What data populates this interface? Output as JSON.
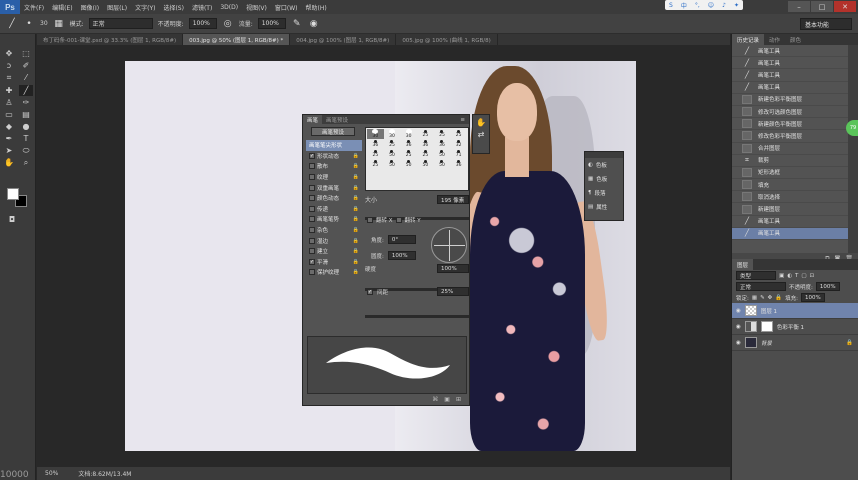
{
  "app": {
    "logo": "Ps"
  },
  "menu": [
    "文件(F)",
    "编辑(E)",
    "图像(I)",
    "图层(L)",
    "文字(Y)",
    "选择(S)",
    "滤镜(T)",
    "3D(D)",
    "视图(V)",
    "窗口(W)",
    "帮助(H)"
  ],
  "options": {
    "size": "30",
    "mode_label": "模式:",
    "mode_value": "正常",
    "opacity_label": "不透明度:",
    "opacity_value": "100%",
    "flow_label": "流量:",
    "flow_value": "100%",
    "workspace": "基本功能"
  },
  "doc_tabs": [
    {
      "label": "布丁码条-001-课堂.psd @ 33.3% (图层 1, RGB/8#)",
      "active": false
    },
    {
      "label": "003.jpg @ 50% (图层 1, RGB/8#) *",
      "active": true
    },
    {
      "label": "004.jpg @ 100% (图层 1, RGB/8#)",
      "active": false
    },
    {
      "label": "005.jpg @ 100% (曲线 1, RGB/8)",
      "active": false
    }
  ],
  "status": {
    "zoom": "50%",
    "doc_info": "文档:8.62M/13.4M"
  },
  "corner_text": "10000",
  "brush_panel": {
    "tabs": [
      "画笔",
      "画笔预设"
    ],
    "preset_button": "画笔预设",
    "options": [
      {
        "label": "画笔笔尖形状",
        "checked": null,
        "selected": true
      },
      {
        "label": "形状动态",
        "checked": true
      },
      {
        "label": "散布",
        "checked": false
      },
      {
        "label": "纹理",
        "checked": false
      },
      {
        "label": "双重画笔",
        "checked": false
      },
      {
        "label": "颜色动态",
        "checked": false
      },
      {
        "label": "传递",
        "checked": false
      },
      {
        "label": "画笔笔势",
        "checked": false
      },
      {
        "label": "杂色",
        "checked": false
      },
      {
        "label": "湿边",
        "checked": false
      },
      {
        "label": "建立",
        "checked": false
      },
      {
        "label": "平滑",
        "checked": true
      },
      {
        "label": "保护纹理",
        "checked": false
      }
    ],
    "tips": [
      {
        "size": "30"
      },
      {
        "size": "30"
      },
      {
        "size": "30"
      },
      {
        "size": "25"
      },
      {
        "size": "25"
      },
      {
        "size": "25"
      },
      {
        "size": "36"
      },
      {
        "size": "25"
      },
      {
        "size": "36"
      },
      {
        "size": "36"
      },
      {
        "size": "36"
      },
      {
        "size": "32"
      },
      {
        "size": "25"
      },
      {
        "size": "50"
      },
      {
        "size": "25"
      },
      {
        "size": "25"
      },
      {
        "size": "50"
      },
      {
        "size": "71"
      },
      {
        "size": "25"
      },
      {
        "size": "50"
      },
      {
        "size": "50"
      },
      {
        "size": "50"
      },
      {
        "size": "50"
      },
      {
        "size": "36"
      }
    ],
    "size_label": "大小",
    "size_value": "195 像素",
    "flip_x": "翻转 X",
    "flip_y": "翻转 Y",
    "angle_label": "角度:",
    "angle_value": "0°",
    "round_label": "圆度:",
    "round_value": "100%",
    "hardness_label": "硬度",
    "hardness_value": "100%",
    "spacing_label": "间距",
    "spacing_value": "25%"
  },
  "float_panel": [
    "色板",
    "色板",
    "段落",
    "属性"
  ],
  "history": {
    "tabs": [
      "历史记录",
      "动作",
      "颜色"
    ],
    "items": [
      {
        "label": "画笔工具",
        "type": "brush"
      },
      {
        "label": "画笔工具",
        "type": "brush"
      },
      {
        "label": "画笔工具",
        "type": "brush"
      },
      {
        "label": "画笔工具",
        "type": "brush"
      },
      {
        "label": "新建色彩平衡图层",
        "type": "doc"
      },
      {
        "label": "修改可选颜色图层",
        "type": "doc"
      },
      {
        "label": "新建颜色平衡图层",
        "type": "doc"
      },
      {
        "label": "修改色彩平衡图层",
        "type": "doc"
      },
      {
        "label": "合并图层",
        "type": "doc"
      },
      {
        "label": "裁剪",
        "type": "crop"
      },
      {
        "label": "矩形选框",
        "type": "doc"
      },
      {
        "label": "填充",
        "type": "doc"
      },
      {
        "label": "取消选择",
        "type": "doc"
      },
      {
        "label": "新建图层",
        "type": "doc"
      },
      {
        "label": "画笔工具",
        "type": "brush"
      },
      {
        "label": "画笔工具",
        "type": "brush",
        "selected": true
      }
    ]
  },
  "badge": "79",
  "layers": {
    "tab": "图层",
    "kind": "类型",
    "blend": "正常",
    "opacity_label": "不透明度:",
    "opacity_value": "100%",
    "lock_label": "锁定:",
    "fill_label": "填充:",
    "fill_value": "100%",
    "items": [
      {
        "name": "图层 1",
        "selected": true
      },
      {
        "name": "色彩平衡 1",
        "selected": false
      },
      {
        "name": "背景",
        "selected": false
      }
    ]
  }
}
